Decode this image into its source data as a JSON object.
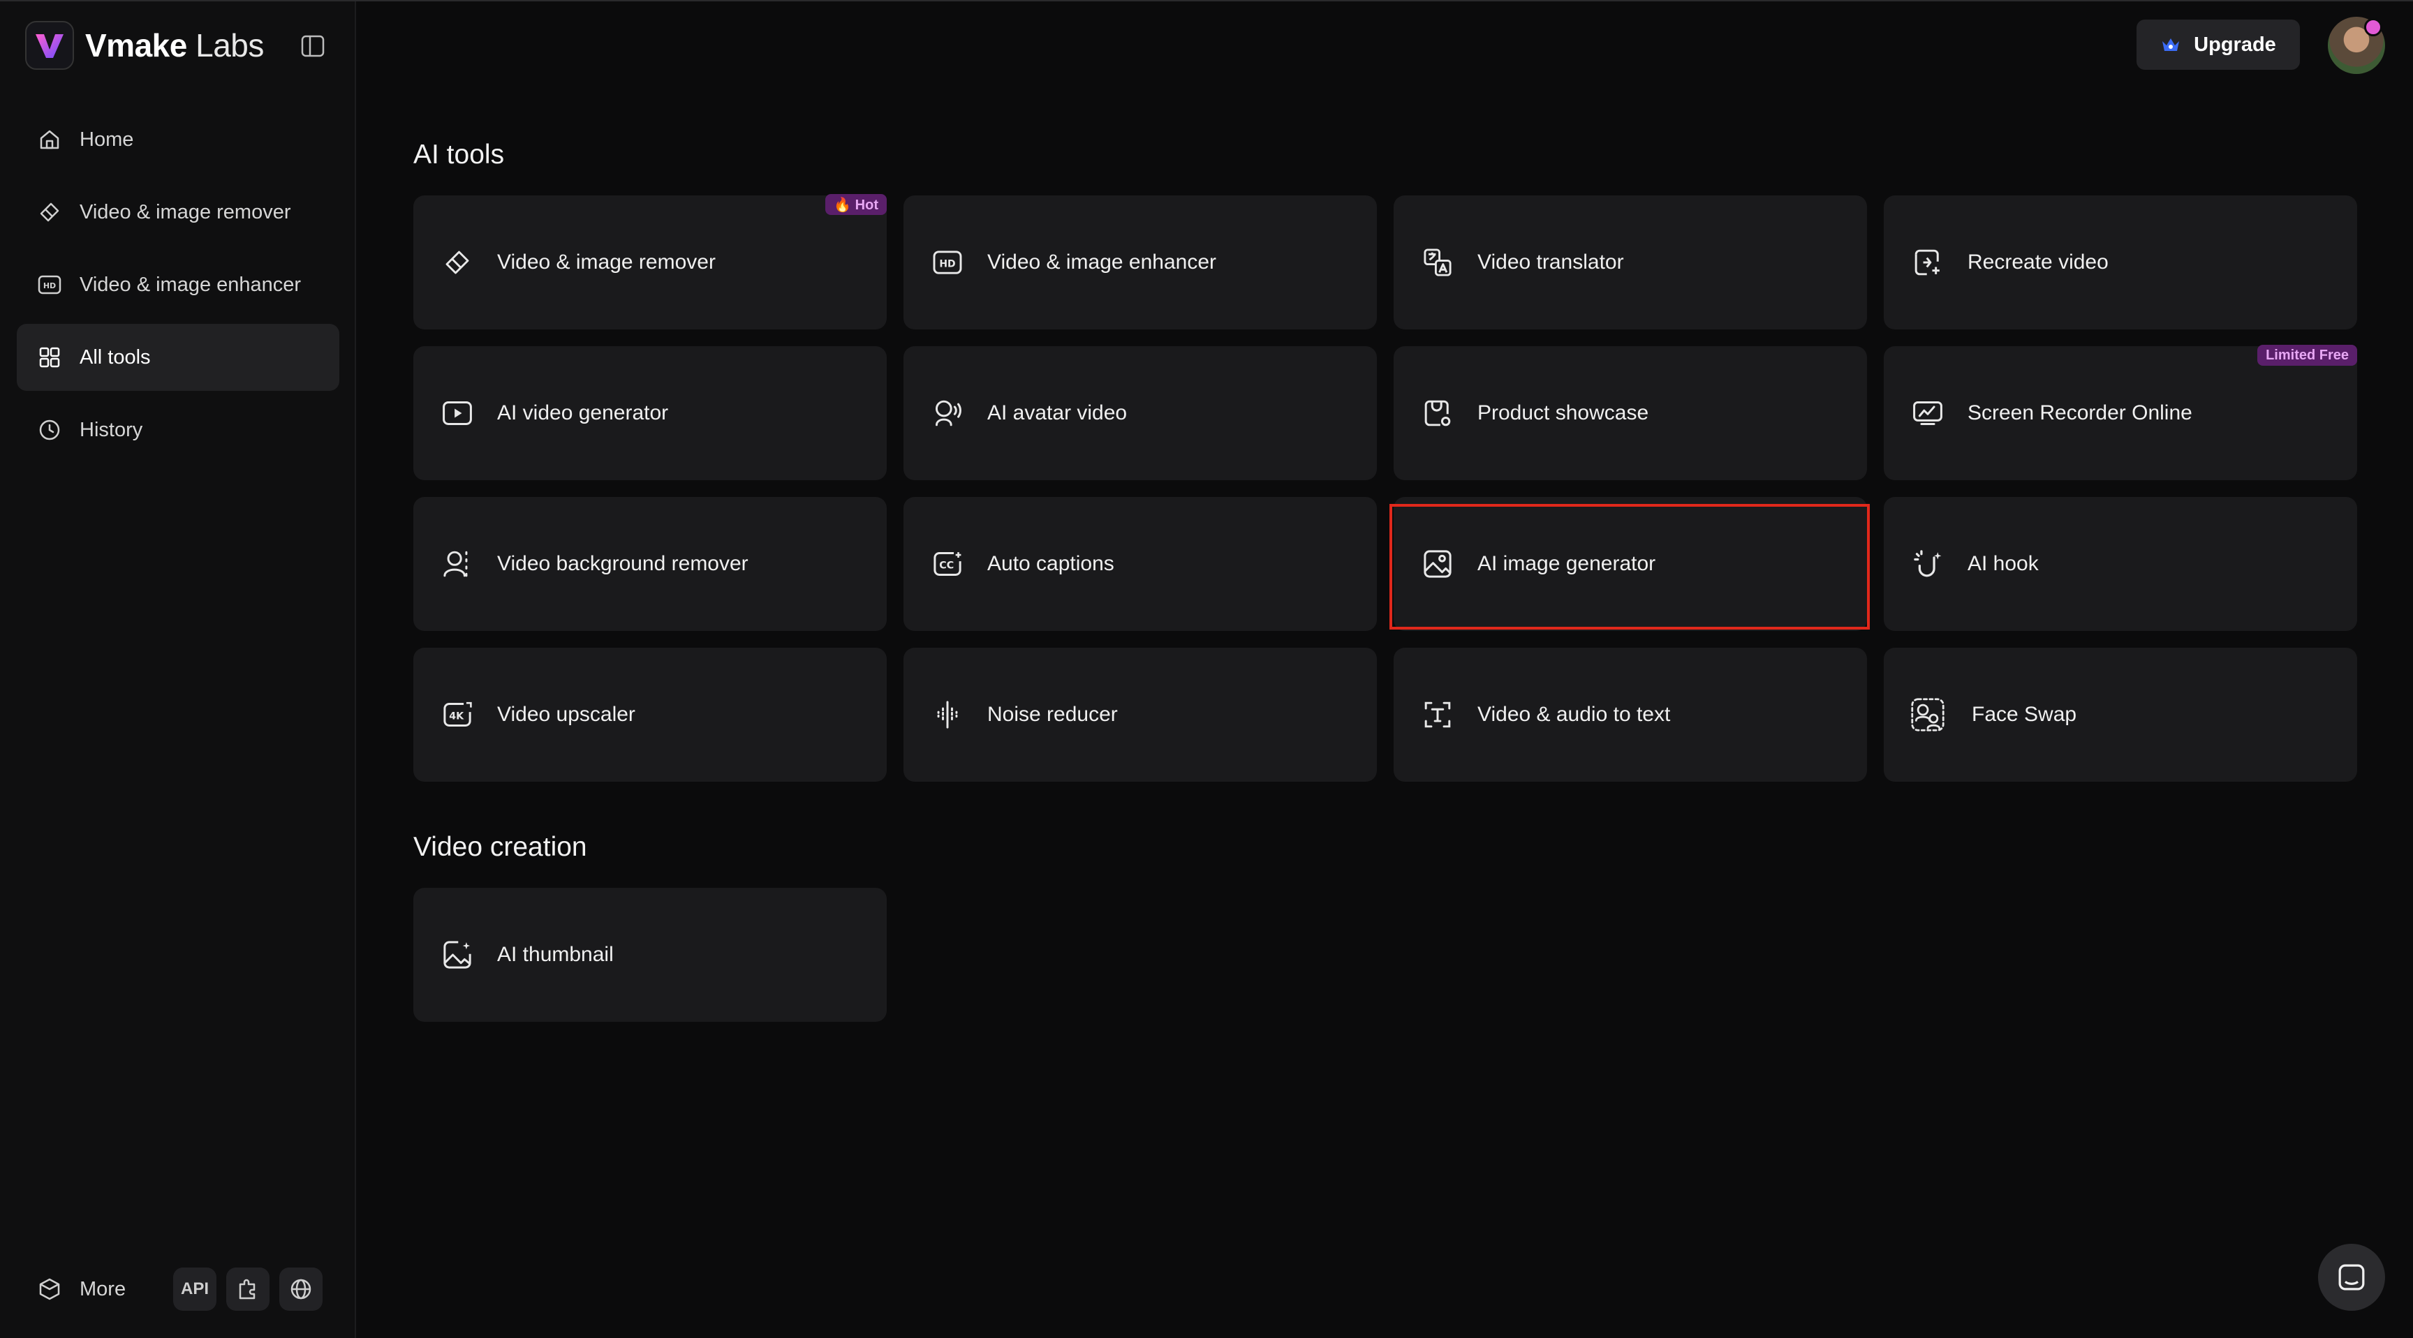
{
  "brand": {
    "name_bold": "Vmake",
    "name_light": "Labs"
  },
  "sidebar": {
    "items": [
      {
        "label": "Home",
        "icon": "home-icon"
      },
      {
        "label": "Video & image remover",
        "icon": "eraser-icon"
      },
      {
        "label": "Video & image enhancer",
        "icon": "hd-icon"
      },
      {
        "label": "All tools",
        "icon": "grid-icon",
        "active": true
      },
      {
        "label": "History",
        "icon": "clock-icon"
      }
    ],
    "more_label": "More",
    "api_label": "API"
  },
  "header": {
    "upgrade_label": "Upgrade"
  },
  "sections": {
    "ai_tools": {
      "title": "AI tools",
      "cards": [
        {
          "label": "Video & image remover",
          "icon": "eraser-icon",
          "badge": "🔥 Hot"
        },
        {
          "label": "Video & image enhancer",
          "icon": "hd-icon"
        },
        {
          "label": "Video translator",
          "icon": "translate-icon"
        },
        {
          "label": "Recreate video",
          "icon": "recreate-icon"
        },
        {
          "label": "AI video generator",
          "icon": "play-icon"
        },
        {
          "label": "AI avatar video",
          "icon": "avatar-icon"
        },
        {
          "label": "Product showcase",
          "icon": "product-icon"
        },
        {
          "label": "Screen Recorder Online",
          "icon": "screen-recorder-icon",
          "badge": "Limited Free"
        },
        {
          "label": "Video background remover",
          "icon": "person-dashed-icon"
        },
        {
          "label": "Auto captions",
          "icon": "cc-icon"
        },
        {
          "label": "AI image generator",
          "icon": "image-icon",
          "highlighted": true
        },
        {
          "label": "AI hook",
          "icon": "magic-hook-icon"
        },
        {
          "label": "Video upscaler",
          "icon": "4k-icon"
        },
        {
          "label": "Noise reducer",
          "icon": "noise-icon"
        },
        {
          "label": "Video & audio to text",
          "icon": "text-scan-icon"
        },
        {
          "label": "Face Swap",
          "icon": "face-swap-icon"
        }
      ]
    },
    "video_creation": {
      "title": "Video creation",
      "cards": [
        {
          "label": "AI thumbnail",
          "icon": "thumbnail-icon"
        }
      ]
    }
  },
  "colors": {
    "background": "#0b0b0c",
    "card": "#1a1a1c",
    "highlight": "#e0281b",
    "badge": "#5a1f6a"
  }
}
